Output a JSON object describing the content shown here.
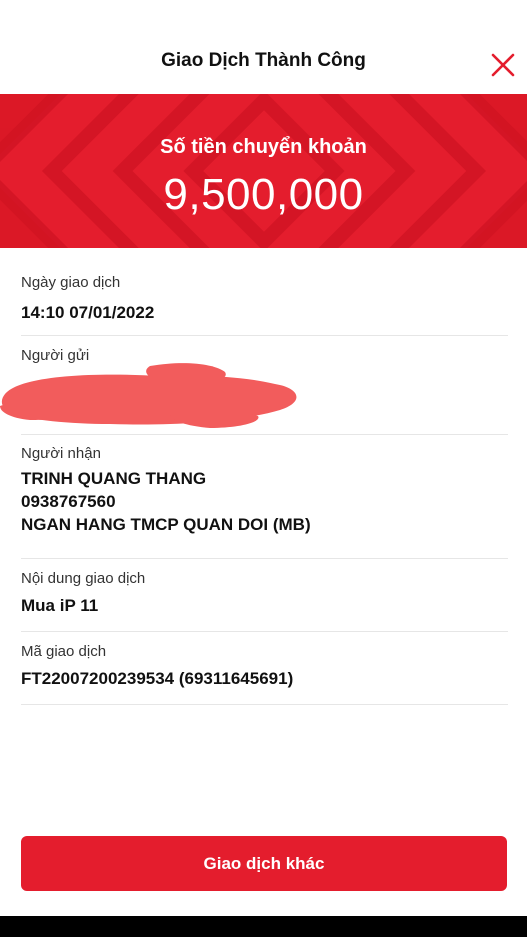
{
  "header": {
    "title": "Giao Dịch Thành Công"
  },
  "banner": {
    "label": "Số tiền chuyển khoản",
    "amount": "9,500,000"
  },
  "details": {
    "date": {
      "label": "Ngày giao dịch",
      "value": "14:10 07/01/2022"
    },
    "sender": {
      "label": "Người gửi",
      "value": ""
    },
    "receiver": {
      "label": "Người nhận",
      "name": "TRINH QUANG THANG",
      "account": "0938767560",
      "bank": "NGAN HANG TMCP QUAN DOI (MB)"
    },
    "content": {
      "label": "Nội dung giao dịch",
      "value": "Mua iP 11"
    },
    "code": {
      "label": "Mã giao dịch",
      "value": "FT22007200239534 (69311645691)"
    }
  },
  "actions": {
    "other_transaction_label": "Giao dịch khác"
  },
  "colors": {
    "accent": "#e41d2d",
    "redaction": "#f25c5c"
  },
  "icons": {
    "close": "close-icon"
  }
}
